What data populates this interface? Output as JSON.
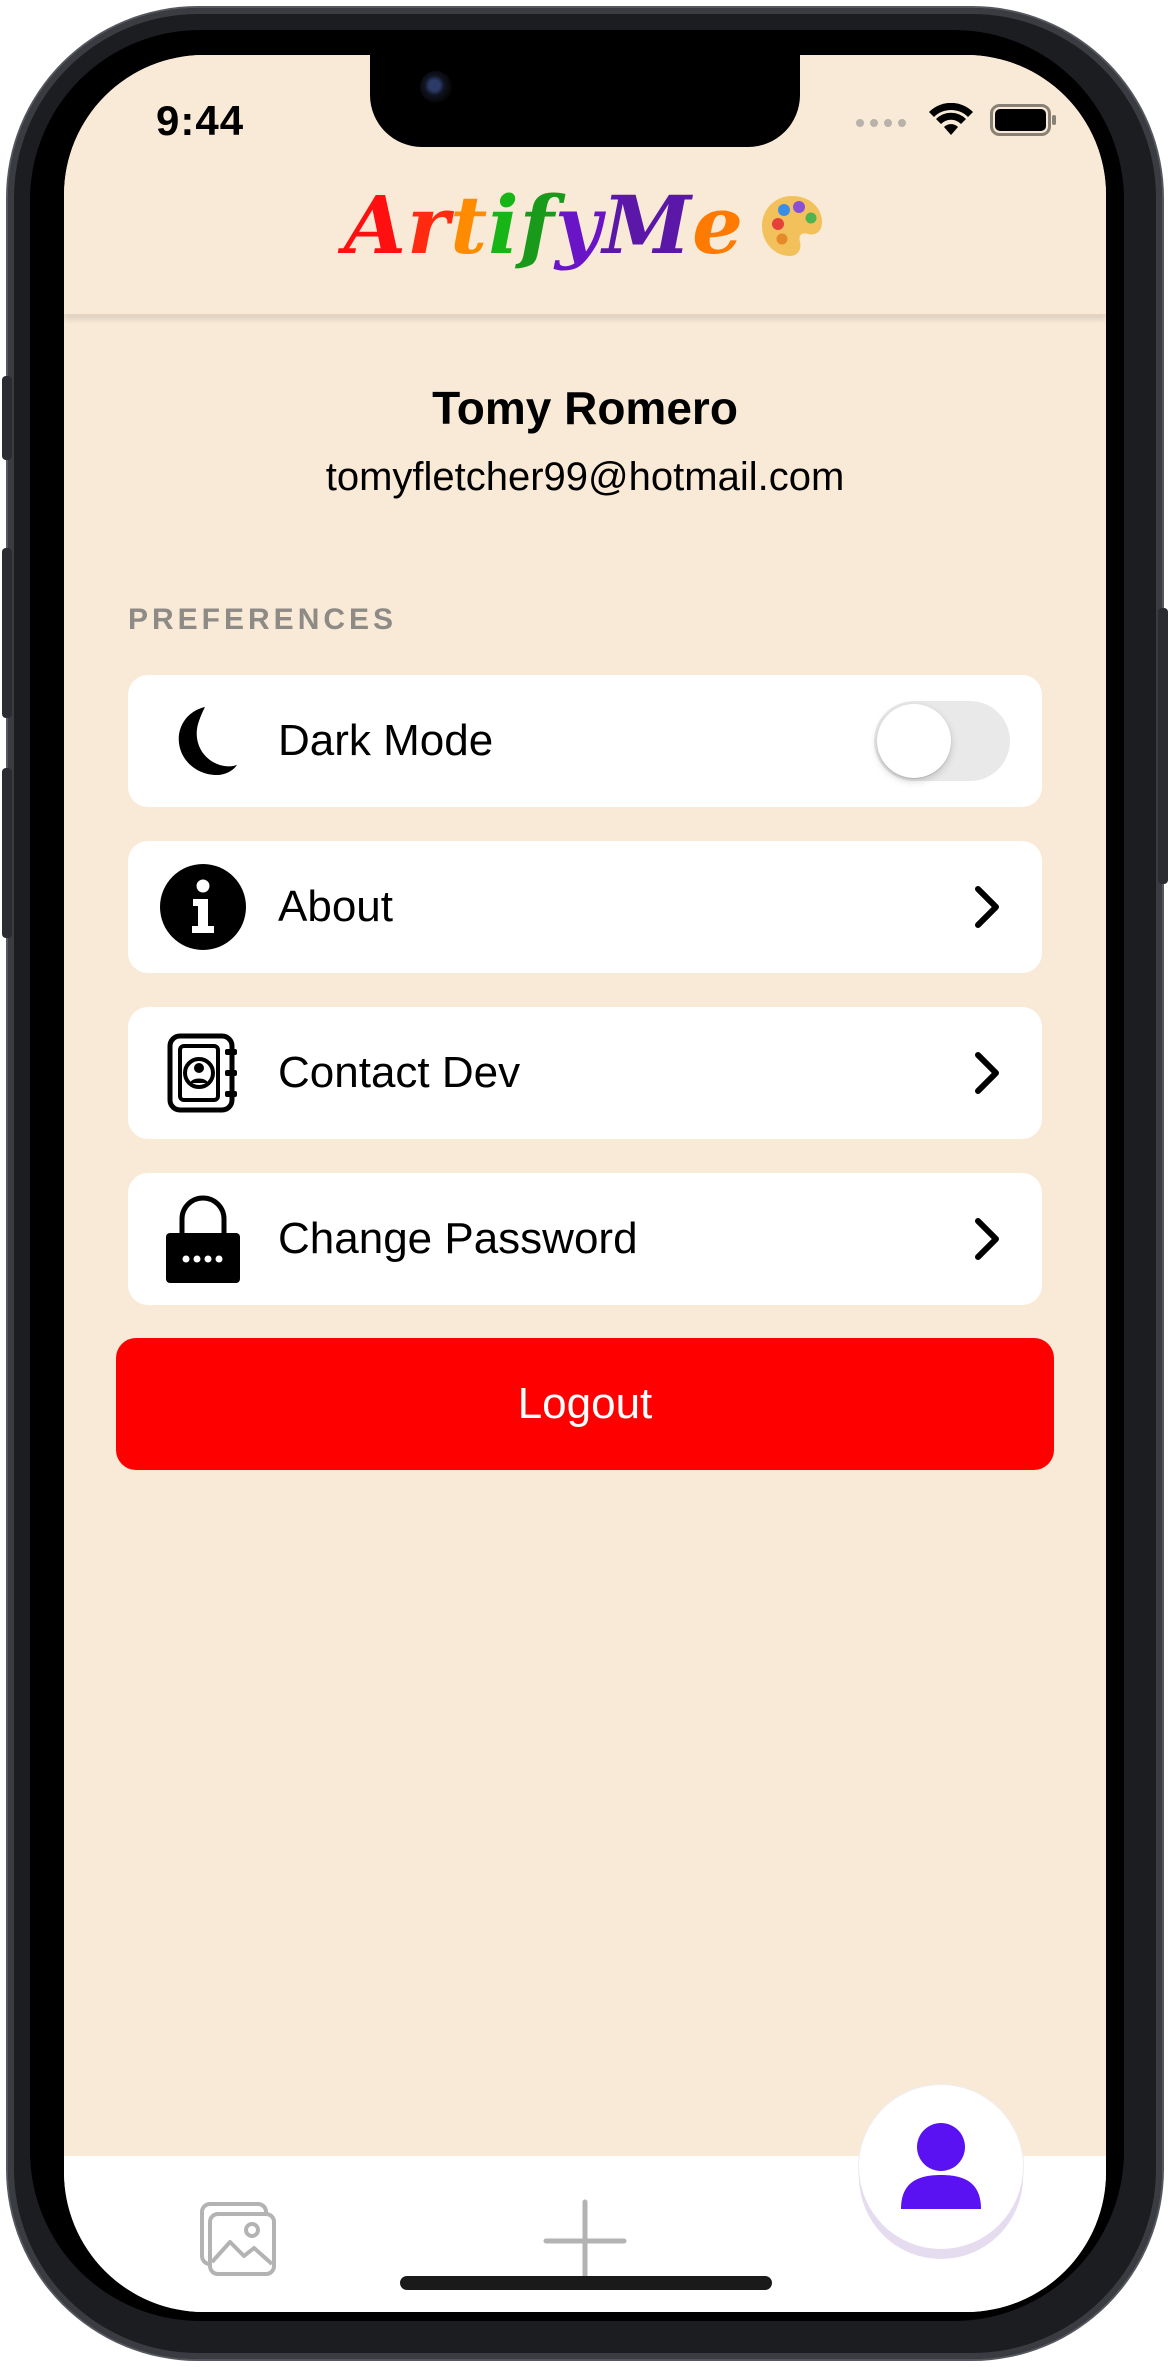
{
  "status_bar": {
    "time": "9:44"
  },
  "header": {
    "logo_letters": [
      {
        "char": "A",
        "color": "#ff1010"
      },
      {
        "char": "r",
        "color": "#ff2a10"
      },
      {
        "char": "t",
        "color": "#ff8c00"
      },
      {
        "char": "i",
        "color": "#17b515"
      },
      {
        "char": "f",
        "color": "#1a9a1a"
      },
      {
        "char": "y",
        "color": "#6a14c7"
      },
      {
        "char": "M",
        "color": "#5b18a8"
      },
      {
        "char": "e",
        "color": "#ff7a00"
      }
    ],
    "palette_icon": "palette-icon"
  },
  "profile": {
    "name": "Tomy Romero",
    "email": "tomyfletcher99@hotmail.com"
  },
  "preferences": {
    "section_label": "PREFERENCES",
    "items": [
      {
        "label": "Dark Mode",
        "icon": "moon-icon",
        "control": "toggle",
        "toggle_on": false
      },
      {
        "label": "About",
        "icon": "info-icon",
        "control": "chevron"
      },
      {
        "label": "Contact Dev",
        "icon": "contact-book-icon",
        "control": "chevron"
      },
      {
        "label": "Change Password",
        "icon": "lock-icon",
        "control": "chevron"
      }
    ]
  },
  "logout": {
    "label": "Logout",
    "color": "#ff0000"
  },
  "tab_bar": {
    "tabs": [
      {
        "icon": "gallery-icon",
        "active": false
      },
      {
        "icon": "plus-icon",
        "active": false
      },
      {
        "icon": "profile-icon",
        "active": true,
        "color": "#5a12f2"
      }
    ]
  }
}
